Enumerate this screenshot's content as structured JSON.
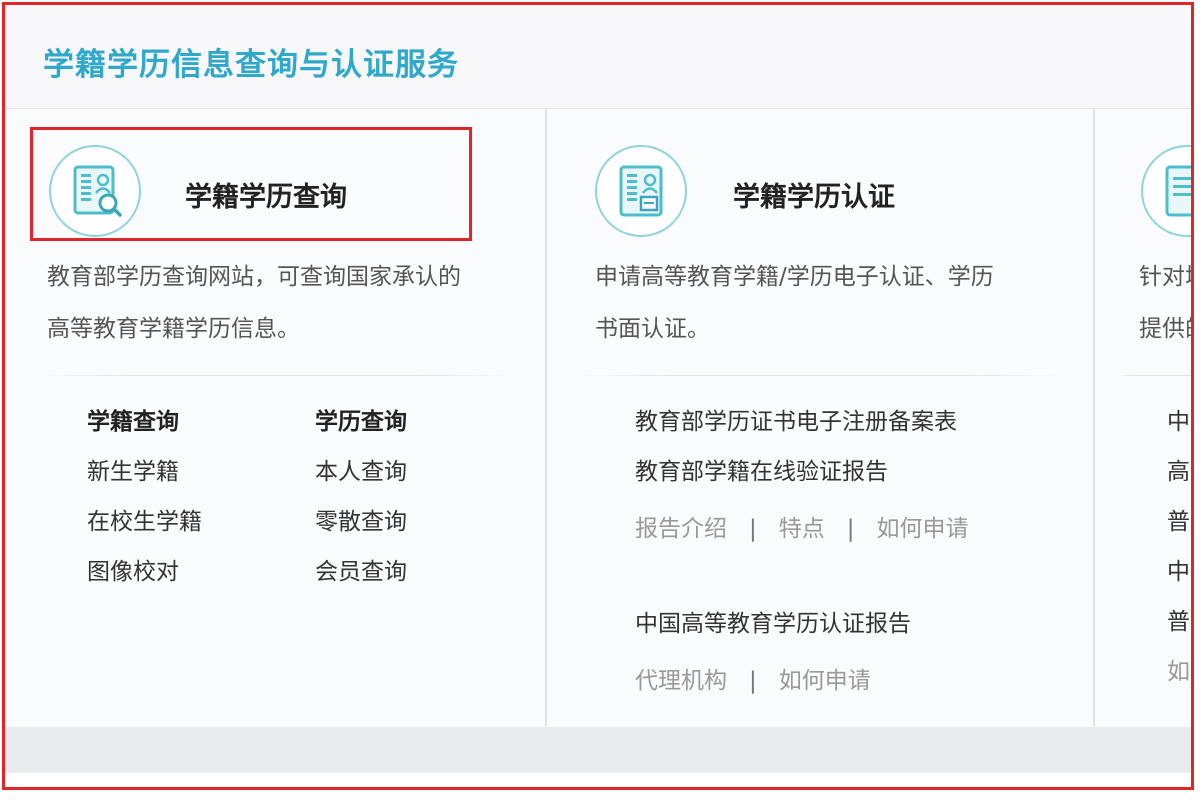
{
  "header": {
    "title": "学籍学历信息查询与认证服务"
  },
  "card1": {
    "icon": "id-card-search-icon",
    "title": "学籍学历查询",
    "desc_lines": [
      "教育部学历查询网站，可查询国家承认的",
      "高等教育学籍学历信息。"
    ],
    "left_column": {
      "header": "学籍查询",
      "items": [
        "新生学籍",
        "在校生学籍",
        "图像校对"
      ]
    },
    "right_column": {
      "header": "学历查询",
      "items": [
        "本人查询",
        "零散查询",
        "会员查询"
      ]
    }
  },
  "card2": {
    "icon": "id-card-certificate-icon",
    "title": "学籍学历认证",
    "desc_lines": [
      "申请高等教育学籍/学历电子认证、学历",
      "书面认证。"
    ],
    "links": [
      "教育部学历证书电子注册备案表",
      "教育部学籍在线验证报告"
    ],
    "sub_links_1": [
      "报告介绍",
      "特点",
      "如何申请"
    ],
    "report_title": "中国高等教育学历认证报告",
    "sub_links_2": [
      "代理机构",
      "如何申请"
    ],
    "separator": "|"
  },
  "card3": {
    "desc_lines": [
      "针对境",
      "提供的"
    ],
    "items": [
      "中等",
      "高等",
      "普通",
      "中等",
      "普通",
      "如何"
    ]
  },
  "colors": {
    "accent": "#2fa8c9",
    "highlight": "#e0262a"
  }
}
